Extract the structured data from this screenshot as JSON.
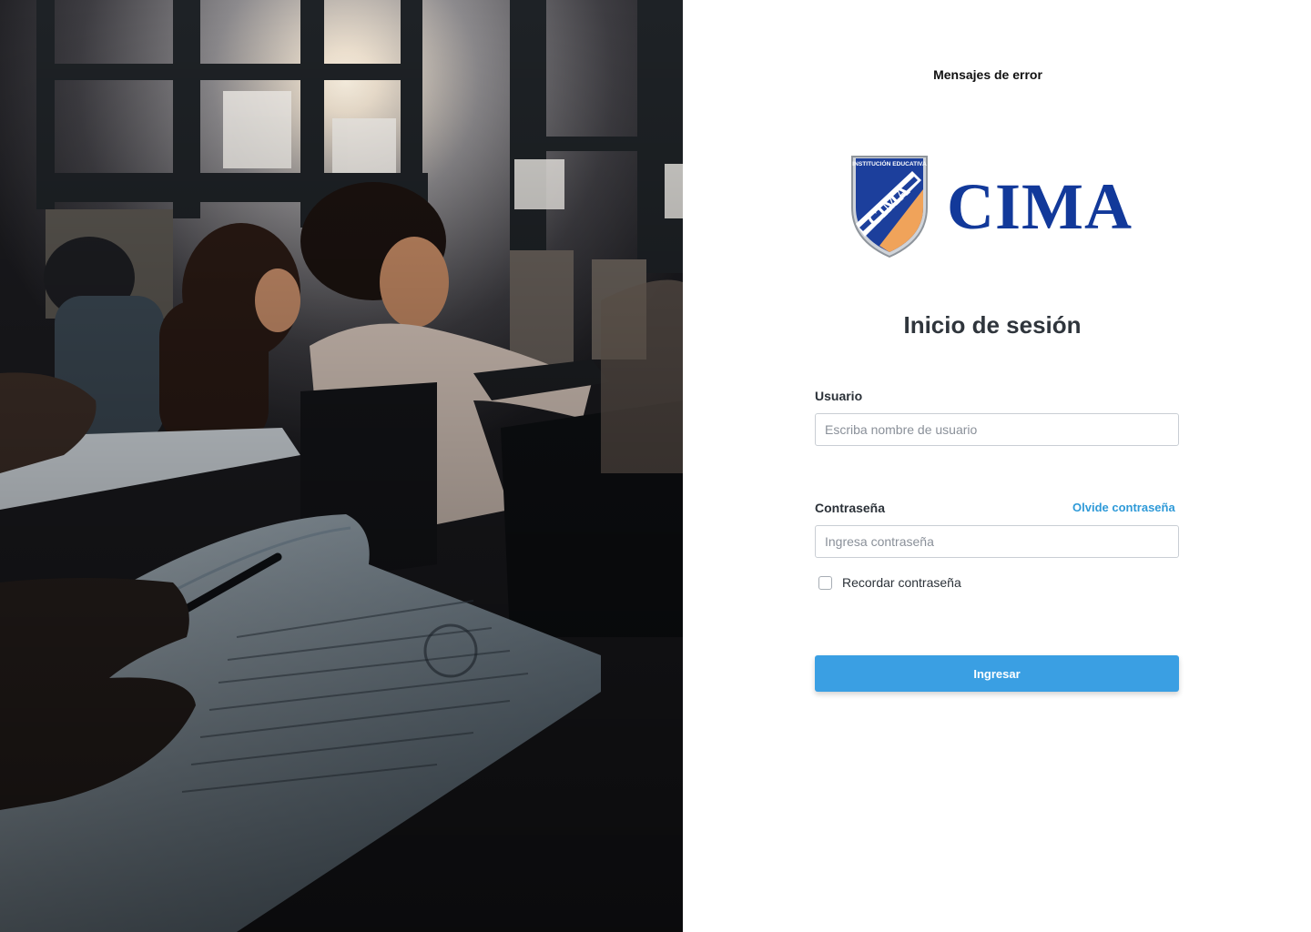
{
  "header": {
    "error_messages_label": "Mensajes de error"
  },
  "brand": {
    "name": "CIMA",
    "shield_text_top": "INSTITUCIÓN EDUCATIVA",
    "shield_text_center": "CIMA",
    "primary_color": "#12399a",
    "accent_color": "#f0a35a"
  },
  "login": {
    "title": "Inicio de sesión",
    "username": {
      "label": "Usuario",
      "placeholder": "Escriba nombre de usuario",
      "value": ""
    },
    "password": {
      "label": "Contraseña",
      "placeholder": "Ingresa contraseña",
      "value": "",
      "forgot_link": "Olvide contraseña"
    },
    "remember": {
      "label": "Recordar contraseña",
      "checked": false
    },
    "submit_label": "Ingresar",
    "submit_color": "#3a9fe3",
    "link_color": "#2f9ad8"
  },
  "hero_image": {
    "icon": "classroom-photo"
  }
}
